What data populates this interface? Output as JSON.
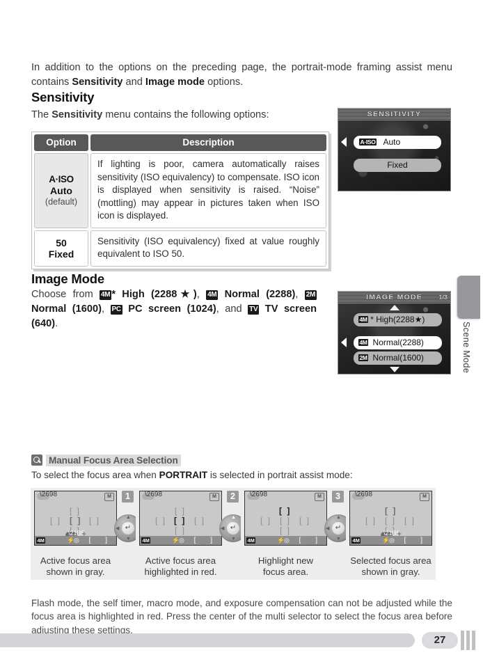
{
  "intro": {
    "text_1": "In addition to the options on the preceding page, the portrait-mode framing assist menu contains ",
    "bold_1": "Sensitivity",
    "text_2": " and ",
    "bold_2": "Image mode",
    "text_3": " options."
  },
  "sensitivity": {
    "heading": "Sensitivity",
    "sub_1": "The ",
    "sub_bold": "Sensitivity",
    "sub_2": " menu contains the following options:",
    "table": {
      "headers": [
        "Option",
        "Description"
      ],
      "rows": [
        {
          "icon": "A·ISO",
          "name": "Auto",
          "note": "(default)",
          "description": "If lighting is poor, camera automatically raises sensitivity (ISO equivalency) to compensate. ISO icon is displayed when sensitivity is raised. “Noise” (mottling) may appear in pictures taken when ISO icon is displayed."
        },
        {
          "icon": "50",
          "name": "Fixed",
          "note": "",
          "description": "Sensitivity (ISO equivalency) fixed at value roughly equivalent to ISO 50."
        }
      ]
    },
    "lcd": {
      "title": "SENSITIVITY",
      "items": [
        {
          "icon": "A·ISO",
          "label": "Auto",
          "selected": true
        },
        {
          "icon": "",
          "label": "Fixed",
          "selected": false
        }
      ]
    }
  },
  "image_mode": {
    "heading": "Image Mode",
    "line_lead": "Choose from ",
    "options": [
      {
        "icon": "4M",
        "star": "*",
        "label": " High (2288★)"
      },
      {
        "icon": "4M",
        "star": "",
        "label": " Normal (2288)"
      },
      {
        "icon": "2M",
        "star": "",
        "label": " Normal (1600)"
      },
      {
        "icon": "PC",
        "star": "",
        "label": " PC screen (1024)"
      },
      {
        "icon": "TV",
        "star": "",
        "label": " TV screen (640)"
      }
    ],
    "joiner_comma": ", ",
    "joiner_and": ", and ",
    "period": ".",
    "lcd": {
      "title": "IMAGE MODE",
      "page": "1/3",
      "items": [
        {
          "icon": "4M",
          "label": "* High(2288★)",
          "selected": false
        },
        {
          "icon": "4M",
          "label": " Normal(2288)",
          "selected": true
        },
        {
          "icon": "2M",
          "label": " Normal(1600)",
          "selected": false
        }
      ]
    }
  },
  "side_tab": {
    "label": "Scene Mode"
  },
  "tip": {
    "icon": "magnifier-icon",
    "title": "Manual Focus Area Selection",
    "sub_1": "To select the focus area when ",
    "sub_bold": "PORTRAIT",
    "sub_2": " is selected in portrait assist mode:",
    "panels": [
      {
        "step": "",
        "caption_1": "Active focus area",
        "caption_2": "shown in gray.",
        "highlight": "center",
        "highlight_color": "gray",
        "show_ok": true
      },
      {
        "step": "1",
        "caption_1": "Active focus area",
        "caption_2": "highlighted in red.",
        "highlight": "center",
        "highlight_color": "red",
        "show_ok": false
      },
      {
        "step": "2",
        "caption_1": "Highlight new",
        "caption_2": "focus area.",
        "highlight": "top",
        "highlight_color": "red",
        "show_ok": false
      },
      {
        "step": "3",
        "caption_1": "Selected focus area",
        "caption_2": "shown in gray.",
        "highlight": "top",
        "highlight_color": "gray",
        "show_ok": true
      }
    ],
    "screen_icons": {
      "mode": "portrait-icon",
      "card": "M",
      "quality": "4M",
      "flash": "⚡",
      "redeye": "◎",
      "bracket": "[     ]"
    }
  },
  "tail": "Flash mode, the self timer, macro mode, and exposure compensation can not be adjusted while the focus area is highlighted in red.  Press the center of the multi selector to select the focus area before adjusting these settings.",
  "footer": {
    "page_number": "27"
  },
  "colors": {
    "header_gray": "#58585a",
    "panel_bg": "#ededed",
    "lcd_dark": "#2a2a2a",
    "tab_gray": "#98989c"
  }
}
